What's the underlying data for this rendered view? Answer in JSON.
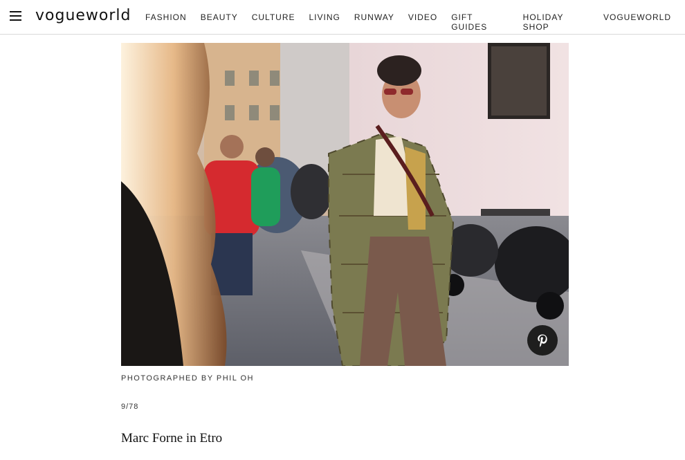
{
  "header": {
    "logo": "vogueworld",
    "nav": [
      "FASHION",
      "BEAUTY",
      "CULTURE",
      "LIVING",
      "RUNWAY",
      "VIDEO",
      "GIFT GUIDES",
      "HOLIDAY SHOP",
      "VOGUEWORLD"
    ]
  },
  "gallery": {
    "photo_credit": "PHOTOGRAPHED BY PHIL OH",
    "counter": "9/78",
    "caption": "Marc Forne in Etro"
  }
}
